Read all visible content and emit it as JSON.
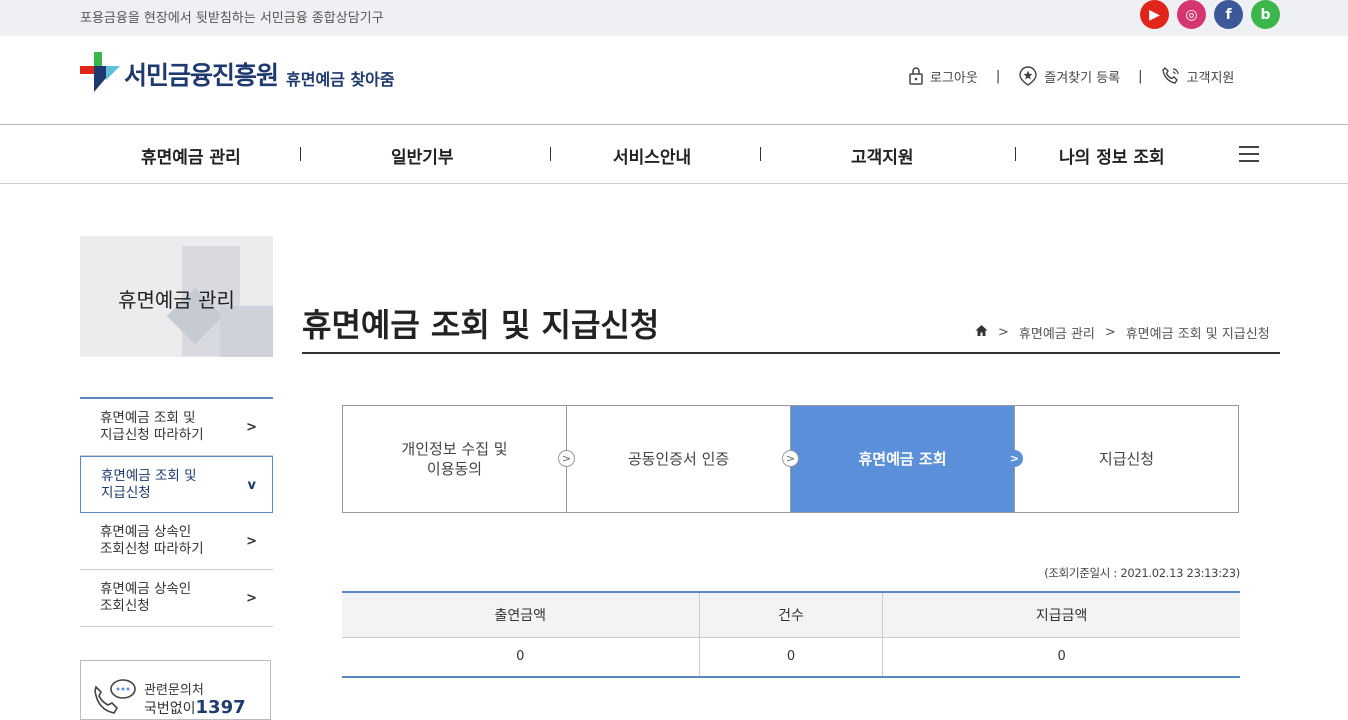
{
  "topbar": {
    "slogan": "포용금융을 현장에서 뒷받침하는 서민금융 종합상담기구"
  },
  "social": [
    {
      "name": "youtube",
      "glyph": "▶",
      "color": "#e0251b"
    },
    {
      "name": "instagram",
      "glyph": "◎",
      "color": "#d6366f"
    },
    {
      "name": "facebook",
      "glyph": "f",
      "color": "#3b5998"
    },
    {
      "name": "blog",
      "glyph": "b",
      "color": "#3cb64a"
    }
  ],
  "logo": {
    "brand": "서민금융진흥원",
    "sub": "휴면예금 찾아줌"
  },
  "util": {
    "logout": "로그아웃",
    "bookmark": "즐겨찾기 등록",
    "support": "고객지원"
  },
  "gnb": [
    "휴면예금 관리",
    "일반기부",
    "서비스안내",
    "고객지원",
    "나의 정보 조회"
  ],
  "lnb": {
    "title": "휴면예금 관리",
    "items": [
      {
        "l1": "휴면예금 조회 및",
        "l2": "지급신청 따라하기",
        "arrow": ">"
      },
      {
        "l1": "휴면예금 조회 및",
        "l2": "지급신청",
        "arrow": "v"
      },
      {
        "l1": "휴면예금 상속인",
        "l2": "조회신청 따라하기",
        "arrow": ">"
      },
      {
        "l1": "휴면예금 상속인",
        "l2": "조회신청",
        "arrow": ">"
      }
    ]
  },
  "contact": {
    "label": "관련문의처",
    "prefix": "국번없이",
    "number": "1397"
  },
  "page": {
    "title": "휴면예금 조회 및 지급신청"
  },
  "breadcrumb": {
    "b1": "휴면예금 관리",
    "b2": "휴면예금 조회 및 지급신청",
    "sep": ">"
  },
  "steps": [
    {
      "l1": "개인정보 수집 및",
      "l2": "이용동의"
    },
    {
      "l1": "공동인증서 인증",
      "l2": ""
    },
    {
      "l1": "휴면예금 조회",
      "l2": ""
    },
    {
      "l1": "지급신청",
      "l2": ""
    }
  ],
  "basis": "(조회기준일시 : 2021.02.13 23:13:23)",
  "table": {
    "headers": [
      "출연금액",
      "건수",
      "지급금액"
    ],
    "row": [
      "0",
      "0",
      "0"
    ]
  },
  "colors": {
    "accent": "#5b8fd9",
    "brand": "#1f3a6e"
  }
}
